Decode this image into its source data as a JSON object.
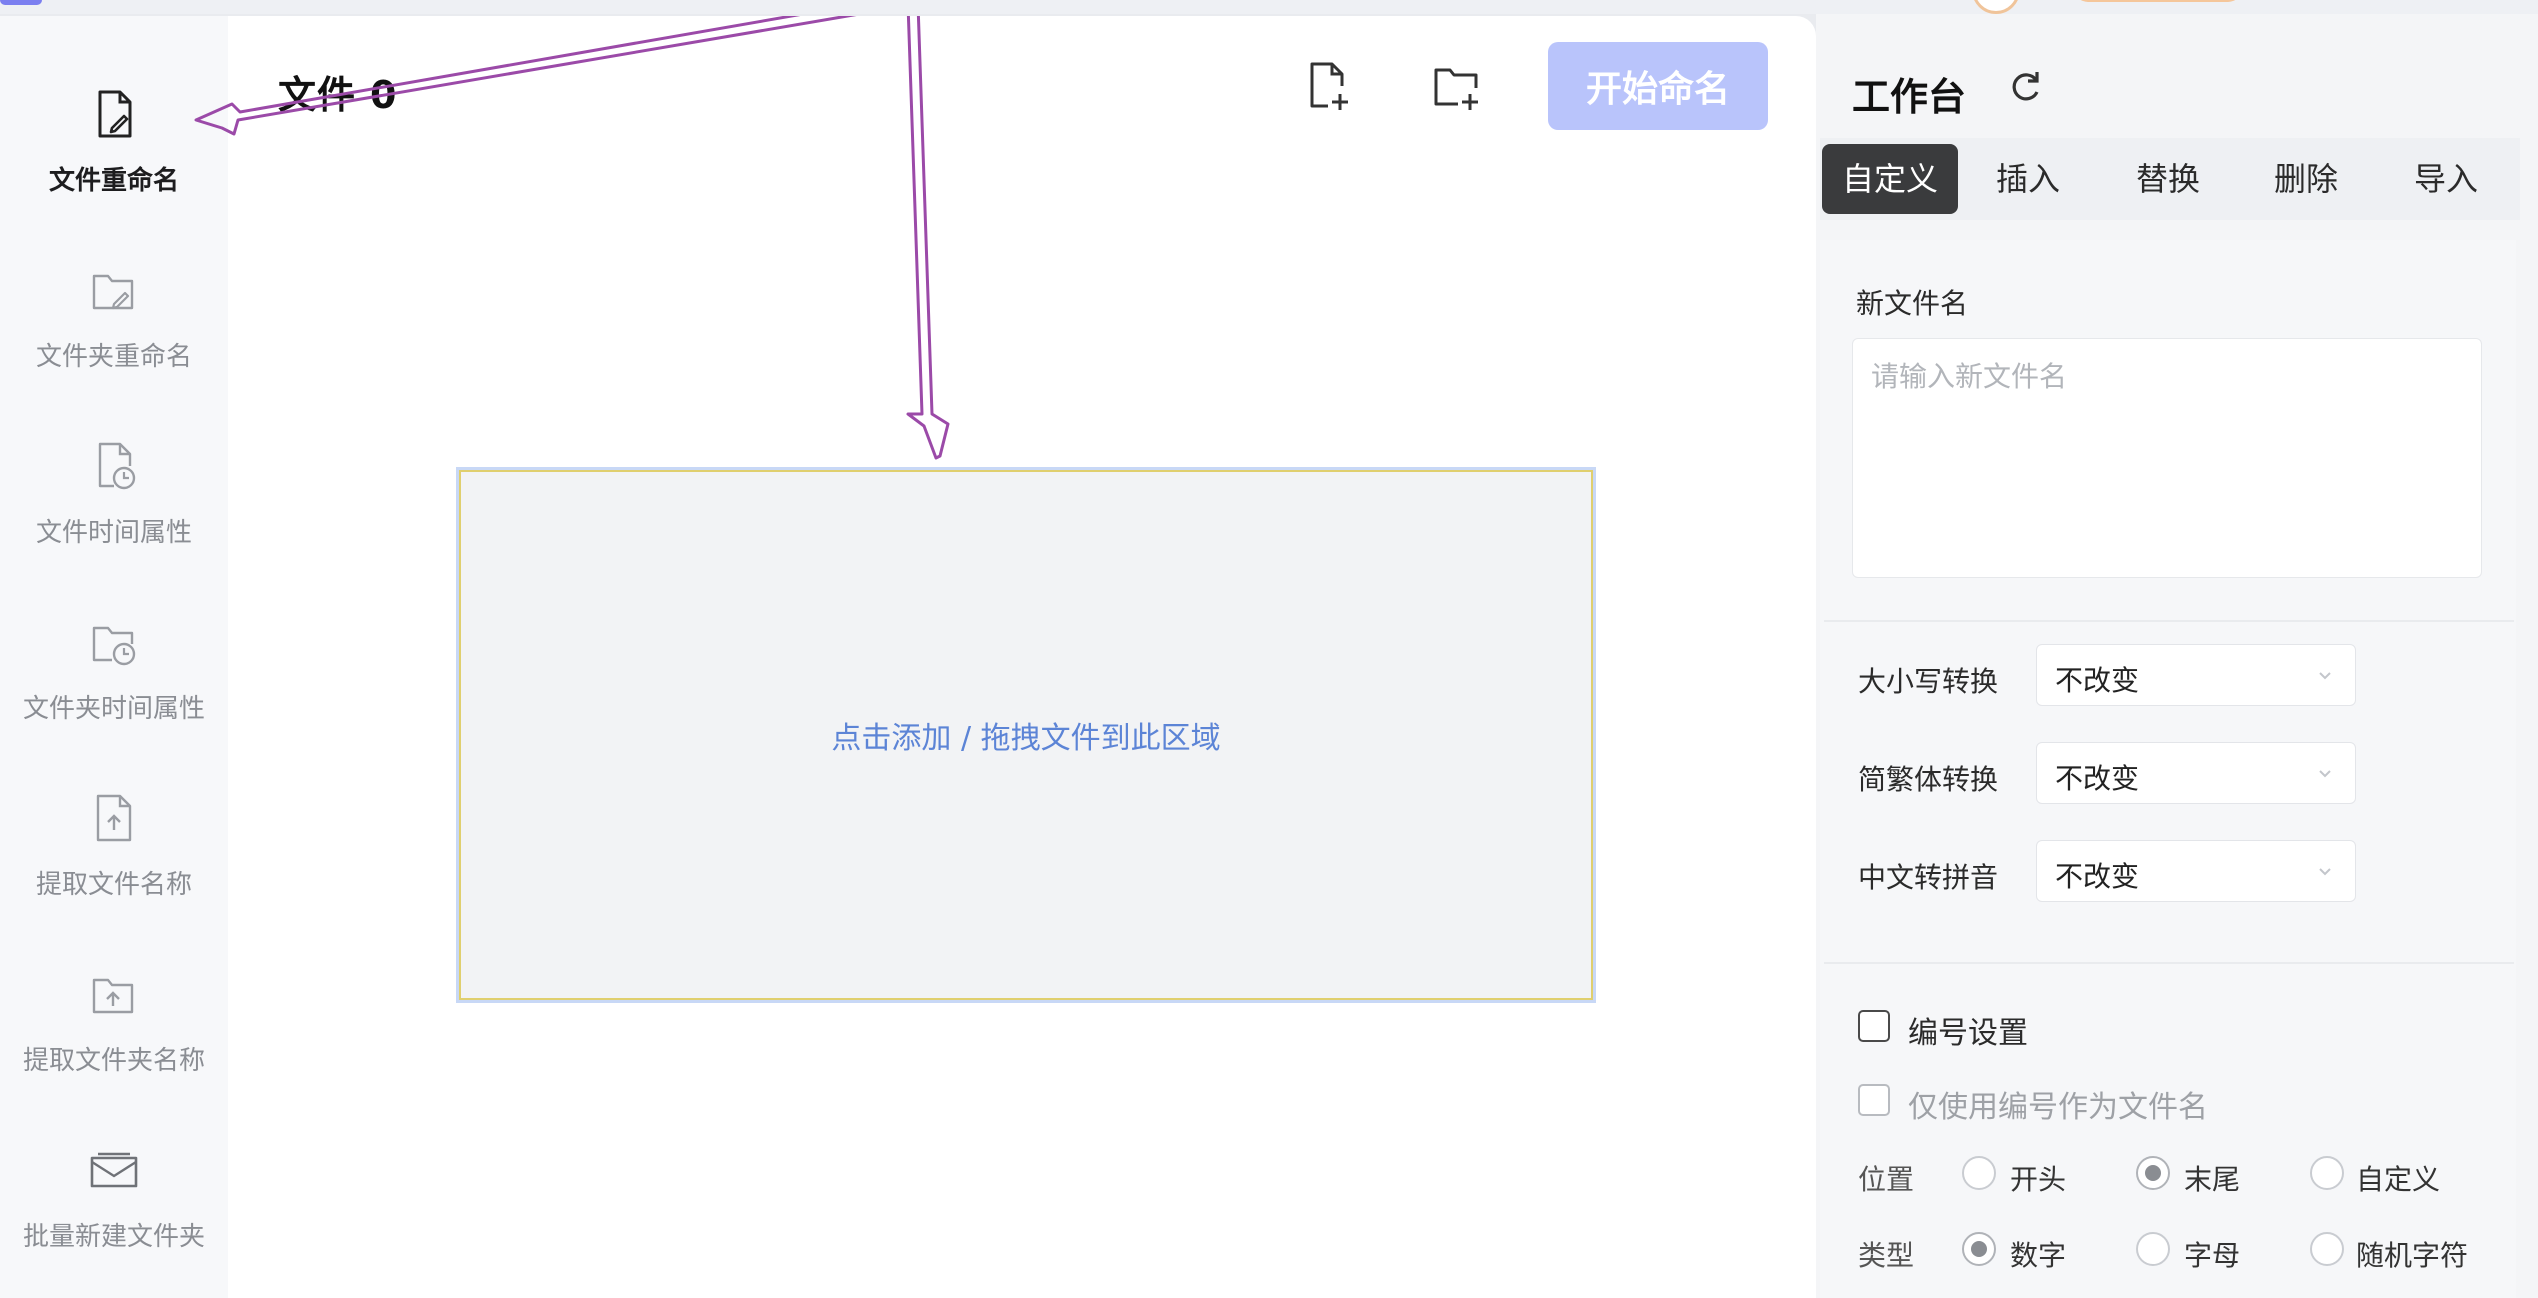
{
  "sidebar": {
    "items": [
      {
        "label": "文件重命名",
        "icon": "file-edit-icon",
        "active": true
      },
      {
        "label": "文件夹重命名",
        "icon": "folder-edit-icon",
        "active": false
      },
      {
        "label": "文件时间属性",
        "icon": "file-clock-icon",
        "active": false
      },
      {
        "label": "文件夹时间属性",
        "icon": "folder-clock-icon",
        "active": false
      },
      {
        "label": "提取文件名称",
        "icon": "file-upload-icon",
        "active": false
      },
      {
        "label": "提取文件夹名称",
        "icon": "folder-upload-icon",
        "active": false
      },
      {
        "label": "批量新建文件夹",
        "icon": "folder-batch-icon",
        "active": false
      }
    ]
  },
  "main": {
    "title": "文件",
    "count": "0",
    "add_file_icon": "add-file-icon",
    "add_folder_icon": "add-folder-icon",
    "start_button": "开始命名",
    "drop_text": "点击添加 / 拖拽文件到此区域"
  },
  "workbench": {
    "title": "工作台",
    "refresh_icon": "refresh-icon",
    "tabs": [
      {
        "label": "自定义",
        "active": true
      },
      {
        "label": "插入",
        "active": false
      },
      {
        "label": "替换",
        "active": false
      },
      {
        "label": "删除",
        "active": false
      },
      {
        "label": "导入",
        "active": false
      }
    ],
    "new_name_label": "新文件名",
    "new_name_placeholder": "请输入新文件名",
    "selects": [
      {
        "label": "大小写转换",
        "value": "不改变"
      },
      {
        "label": "简繁体转换",
        "value": "不改变"
      },
      {
        "label": "中文转拼音",
        "value": "不改变"
      }
    ],
    "numbering_label": "编号设置",
    "only_number_label": "仅使用编号作为文件名",
    "position": {
      "label": "位置",
      "options": [
        "开头",
        "末尾",
        "自定义"
      ],
      "selected": "末尾"
    },
    "type": {
      "label": "类型",
      "options": [
        "数字",
        "字母",
        "随机字符"
      ],
      "selected": "数字"
    }
  },
  "colors": {
    "accent": "#b9c4fb",
    "arrow": "#9b4aa8",
    "drop_text": "#5c84d6",
    "active_tab": "#3a3b3d"
  }
}
